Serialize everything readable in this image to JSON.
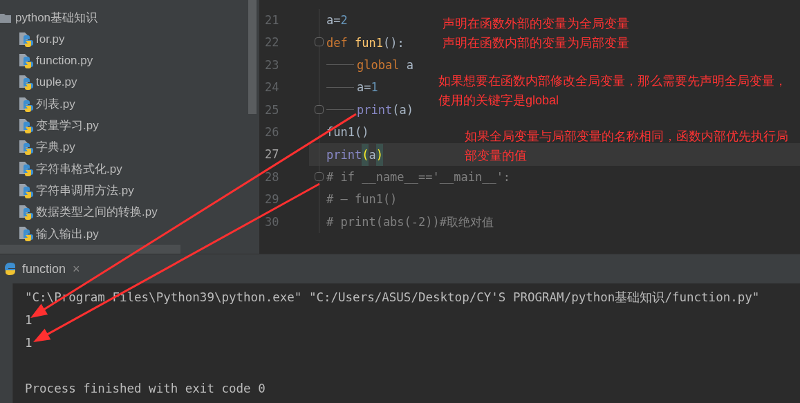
{
  "project_tree": {
    "folder": "python基础知识",
    "files": [
      {
        "name": "for.py",
        "selected": false
      },
      {
        "name": "function.py",
        "selected": false
      },
      {
        "name": "tuple.py",
        "selected": false
      },
      {
        "name": "列表.py",
        "selected": false
      },
      {
        "name": "变量学习.py",
        "selected": false
      },
      {
        "name": "字典.py",
        "selected": false
      },
      {
        "name": "字符串格式化.py",
        "selected": false
      },
      {
        "name": "字符串调用方法.py",
        "selected": false
      },
      {
        "name": "数据类型之间的转换.py",
        "selected": false
      },
      {
        "name": "输入输出.py",
        "selected": false
      }
    ]
  },
  "editor": {
    "lines": [
      {
        "number": "21",
        "current": false,
        "fold": false,
        "tokens": [
          {
            "kind": "plain",
            "text": "a="
          },
          {
            "kind": "number",
            "text": "2"
          }
        ]
      },
      {
        "number": "22",
        "current": false,
        "fold": true,
        "tokens": [
          {
            "kind": "keyword",
            "text": "def "
          },
          {
            "kind": "func",
            "text": "fun1"
          },
          {
            "kind": "plain",
            "text": "():"
          }
        ]
      },
      {
        "number": "23",
        "current": false,
        "fold": false,
        "tokens": [
          {
            "kind": "tab"
          },
          {
            "kind": "keyword",
            "text": "global "
          },
          {
            "kind": "plain",
            "text": "a"
          }
        ]
      },
      {
        "number": "24",
        "current": false,
        "fold": false,
        "tokens": [
          {
            "kind": "tab"
          },
          {
            "kind": "plain",
            "text": "a="
          },
          {
            "kind": "number",
            "text": "1"
          }
        ]
      },
      {
        "number": "25",
        "current": false,
        "fold": true,
        "tokens": [
          {
            "kind": "tab"
          },
          {
            "kind": "builtin",
            "text": "print"
          },
          {
            "kind": "plain",
            "text": "(a)"
          }
        ]
      },
      {
        "number": "26",
        "current": false,
        "fold": false,
        "tokens": [
          {
            "kind": "plain",
            "text": "fun1()"
          }
        ]
      },
      {
        "number": "27",
        "current": true,
        "fold": false,
        "tokens": [
          {
            "kind": "builtin",
            "text": "print"
          },
          {
            "kind": "bracket",
            "text": "("
          },
          {
            "kind": "plain",
            "text": "a"
          },
          {
            "kind": "bracket",
            "text": ")"
          }
        ]
      },
      {
        "number": "28",
        "current": false,
        "fold": true,
        "tokens": [
          {
            "kind": "comment",
            "text": "# if __name__=='__main__':"
          }
        ]
      },
      {
        "number": "29",
        "current": false,
        "fold": false,
        "tokens": [
          {
            "kind": "comment",
            "text": "# — fun1()"
          }
        ]
      },
      {
        "number": "30",
        "current": false,
        "fold": false,
        "tokens": [
          {
            "kind": "comment",
            "text": "# print(abs(-2))#取绝对值"
          }
        ]
      }
    ]
  },
  "annotations": [
    "声明在函数外部的变量为全局变量",
    "声明在函数内部的变量为局部变量",
    "如果想要在函数内部修改全局变量，那么需要先声明全局变量，使用的关键字是global",
    "如果全局变量与局部变量的名称相同，函数内部优先执行局部变量的值"
  ],
  "run_panel": {
    "tab": "function",
    "close": "×",
    "output": [
      {
        "kind": "line",
        "text": "\"C:\\Program Files\\Python39\\python.exe\" \"C:/Users/ASUS/Desktop/CY'S PROGRAM/python基础知识/function.py\""
      },
      {
        "kind": "line",
        "text": "1"
      },
      {
        "kind": "line",
        "text": "1"
      },
      {
        "kind": "status",
        "text": "Process finished with exit code 0"
      }
    ]
  }
}
